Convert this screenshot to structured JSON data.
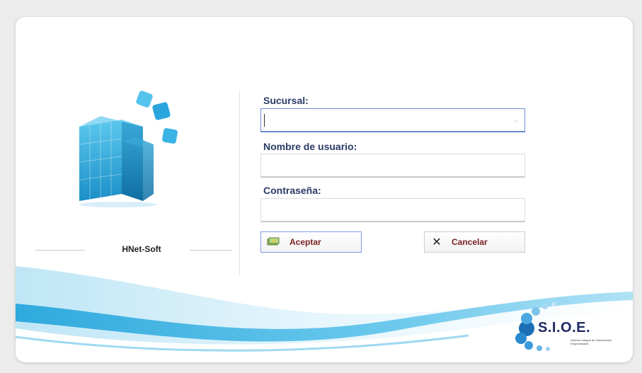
{
  "brand": {
    "name": "HNet-Soft"
  },
  "form": {
    "sucursal_label": "Sucursal:",
    "sucursal_value": "",
    "usuario_label": "Nombre de usuario:",
    "usuario_value": "",
    "password_label": "Contraseña:",
    "password_value": ""
  },
  "buttons": {
    "accept": "Aceptar",
    "cancel": "Cancelar"
  },
  "partner_logo": {
    "name": "S.I.O.E.",
    "tagline": "Sistema Integral de Operaciones Empresariales"
  },
  "icons": {
    "accept": "money-bill-icon",
    "cancel": "close-x-icon",
    "dropdown": "chevron-down-icon",
    "app_logo": "cube-stack-icon",
    "partner_logo": "bubble-logo-icon"
  },
  "colors": {
    "label": "#2a3a66",
    "button_text": "#7a1f1f",
    "accent_border": "#7c9ce6",
    "wave": "#29a9dc"
  }
}
